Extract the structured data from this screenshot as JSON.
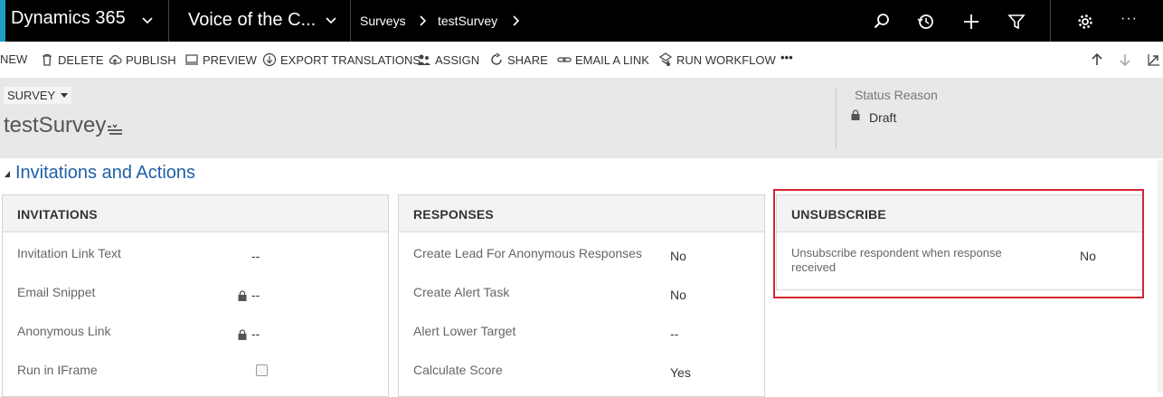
{
  "topnav": {
    "app_name": "Dynamics 365",
    "area_name": "Voice of the C...",
    "breadcrumb": [
      "Surveys",
      "testSurvey"
    ],
    "accent_color": "#1ea0c8",
    "icons": [
      "search-icon",
      "history-icon",
      "plus-icon",
      "filter-icon",
      "gear-icon",
      "more-icon"
    ],
    "more_label": "···"
  },
  "commands": [
    {
      "label": "NEW",
      "icon": "none"
    },
    {
      "label": "DELETE",
      "icon": "trash-icon"
    },
    {
      "label": "PUBLISH",
      "icon": "cloud-icon"
    },
    {
      "label": "PREVIEW",
      "icon": "preview-icon"
    },
    {
      "label": "EXPORT TRANSLATIONS",
      "icon": "export-icon"
    },
    {
      "label": "ASSIGN",
      "icon": "people-icon"
    },
    {
      "label": "SHARE",
      "icon": "share-icon"
    },
    {
      "label": "EMAIL A LINK",
      "icon": "link-icon"
    },
    {
      "label": "RUN WORKFLOW",
      "icon": "workflow-icon"
    }
  ],
  "commands_more": "•••",
  "header": {
    "entity": "SURVEY",
    "record_title": "testSurvey",
    "status_label": "Status Reason",
    "status_value": "Draft"
  },
  "section": {
    "title": "Invitations and Actions"
  },
  "invitations": {
    "heading": "INVITATIONS",
    "rows": [
      {
        "label": "Invitation Link Text",
        "value": "--",
        "locked": false
      },
      {
        "label": "Email Snippet",
        "value": "--",
        "locked": true
      },
      {
        "label": "Anonymous Link",
        "value": "--",
        "locked": true
      },
      {
        "label": "Run in IFrame",
        "value": "",
        "checkbox": true,
        "checked": false
      }
    ]
  },
  "responses": {
    "heading": "RESPONSES",
    "rows": [
      {
        "label": "Create Lead For Anonymous Responses",
        "value": "No"
      },
      {
        "label": "Create Alert Task",
        "value": "No"
      },
      {
        "label": "Alert Lower Target",
        "value": "--"
      },
      {
        "label": "Calculate Score",
        "value": "Yes"
      }
    ]
  },
  "unsubscribe": {
    "heading": "UNSUBSCRIBE",
    "row_label_line1": "Unsubscribe respondent when response",
    "row_label_line2": "received",
    "row_value": "No",
    "highlight_color": "#d4262e"
  }
}
